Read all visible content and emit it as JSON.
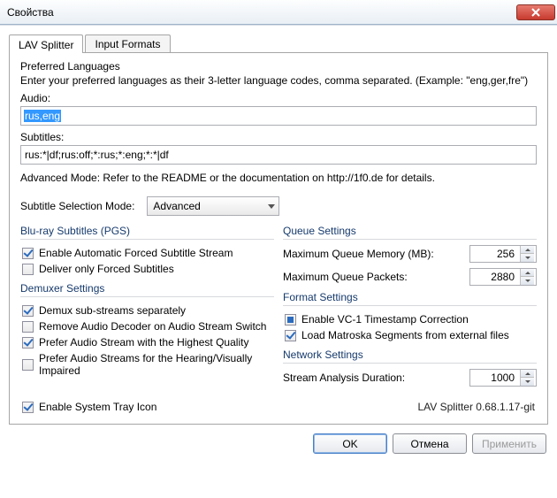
{
  "window": {
    "title": "Свойства"
  },
  "tabs": {
    "splitter": "LAV Splitter",
    "input": "Input Formats"
  },
  "pref": {
    "heading": "Preferred Languages",
    "desc": "Enter your preferred languages as their 3-letter language codes, comma separated. (Example: \"eng,ger,fre\")",
    "audioLabel": "Audio:",
    "audioValue": "rus,eng",
    "subsLabel": "Subtitles:",
    "subsValue": "rus:*|df;rus:off;*:rus;*:eng;*:*|df",
    "advNote": "Advanced Mode: Refer to the README or the documentation on http://1f0.de for details."
  },
  "mode": {
    "label": "Subtitle Selection Mode:",
    "value": "Advanced"
  },
  "bluray": {
    "caption": "Blu-ray Subtitles (PGS)",
    "autoForced": "Enable Automatic Forced Subtitle Stream",
    "deliverForced": "Deliver only Forced Subtitles"
  },
  "demux": {
    "caption": "Demuxer Settings",
    "sep": "Demux sub-streams separately",
    "removeDec": "Remove Audio Decoder on Audio Stream Switch",
    "hq": "Prefer Audio Stream with the Highest Quality",
    "impaired": "Prefer Audio Streams for the Hearing/Visually Impaired"
  },
  "queue": {
    "caption": "Queue Settings",
    "memLabel": "Maximum Queue Memory (MB):",
    "memValue": "256",
    "pktLabel": "Maximum Queue Packets:",
    "pktValue": "2880"
  },
  "format": {
    "caption": "Format Settings",
    "vc1": "Enable VC-1 Timestamp Correction",
    "matroska": "Load Matroska Segments from external files"
  },
  "network": {
    "caption": "Network Settings",
    "analysisLabel": "Stream Analysis Duration:",
    "analysisValue": "1000"
  },
  "tray": "Enable System Tray Icon",
  "version": "LAV Splitter 0.68.1.17-git",
  "buttons": {
    "ok": "OK",
    "cancel": "Отмена",
    "apply": "Применить"
  }
}
